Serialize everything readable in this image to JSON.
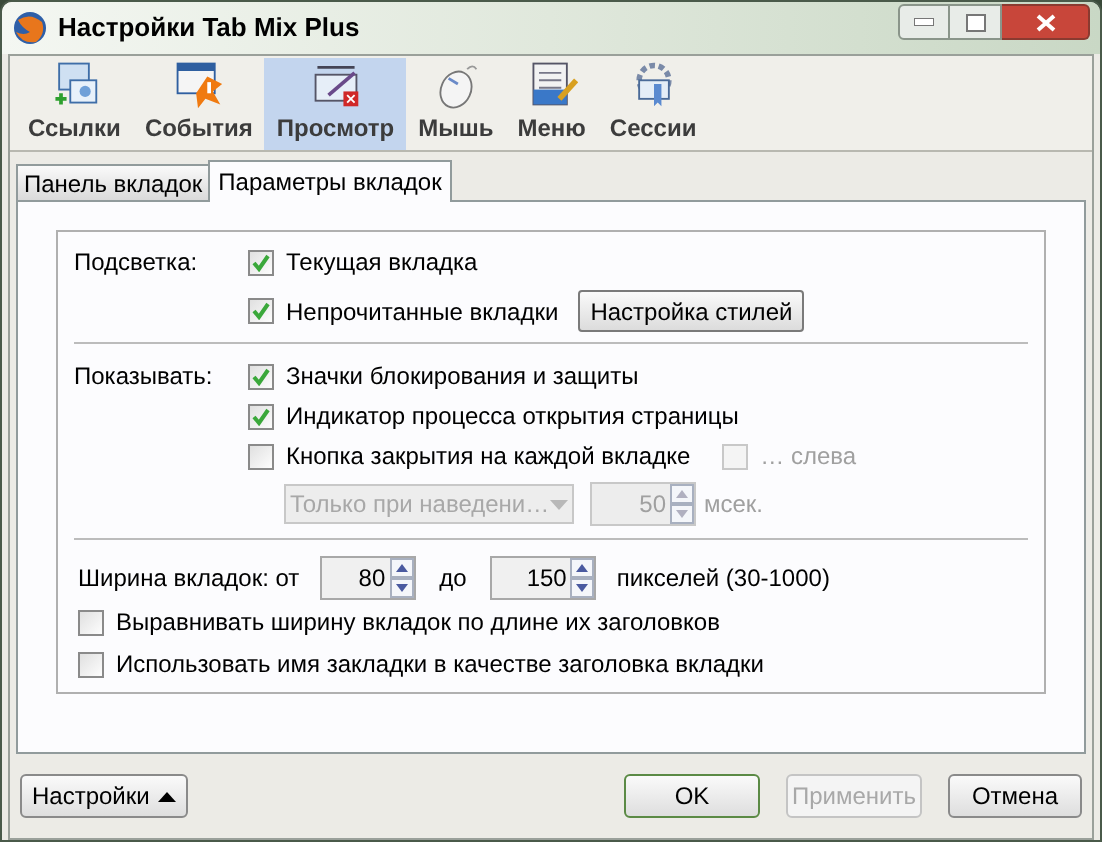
{
  "window": {
    "title": "Настройки Tab Mix Plus"
  },
  "toolbar": [
    {
      "label": "Ссылки",
      "selected": false
    },
    {
      "label": "События",
      "selected": false
    },
    {
      "label": "Просмотр",
      "selected": true
    },
    {
      "label": "Мышь",
      "selected": false
    },
    {
      "label": "Меню",
      "selected": false
    },
    {
      "label": "Сессии",
      "selected": false
    }
  ],
  "tabs": [
    {
      "label": "Панель вкладок",
      "selected": false
    },
    {
      "label": "Параметры вкладок",
      "selected": true
    }
  ],
  "highlight": {
    "label": "Подсветка:",
    "options": [
      {
        "label": "Текущая вкладка",
        "checked": true
      },
      {
        "label": "Непрочитанные вкладки",
        "checked": true
      }
    ],
    "button": "Настройка стилей"
  },
  "show": {
    "label": "Показывать:",
    "options": [
      {
        "label": "Значки блокирования и защиты",
        "checked": true
      },
      {
        "label": "Индикатор процесса открытия страницы",
        "checked": true
      },
      {
        "label": "Кнопка закрытия на каждой вкладке",
        "checked": false
      }
    ],
    "left_option": {
      "label": "… слева",
      "checked": false,
      "disabled": true
    },
    "close_mode": {
      "value": "Только при наведени…",
      "disabled": true
    },
    "delay": {
      "value": "50",
      "unit": "мсек.",
      "disabled": true
    }
  },
  "tab_width": {
    "label": "Ширина вкладок: от",
    "min": "80",
    "to_label": "до",
    "max": "150",
    "range_label": "пикселей (30-1000)",
    "options": [
      {
        "label": "Выравнивать ширину вкладок по длине их заголовков",
        "checked": false
      },
      {
        "label": "Использовать имя закладки в качестве заголовка вкладки",
        "checked": false
      }
    ]
  },
  "footer": {
    "menu_button": "Настройки",
    "ok": "OK",
    "apply": {
      "label": "Применить",
      "disabled": true
    },
    "cancel": "Отмена"
  }
}
